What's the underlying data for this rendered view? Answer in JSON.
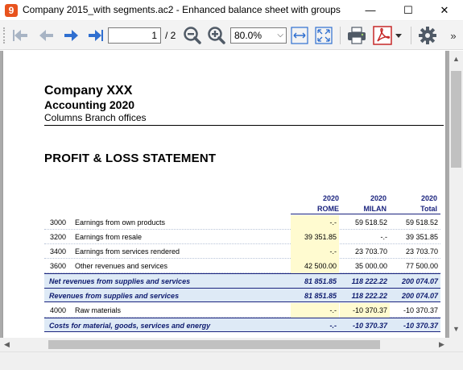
{
  "window": {
    "title": "Company 2015_with segments.ac2 - Enhanced balance sheet with groups",
    "app_icon": "9",
    "minimize": "—",
    "maximize": "☐",
    "close": "✕"
  },
  "toolbar": {
    "page_current": "1",
    "page_total": "/ 2",
    "zoom": "80.0%",
    "more": "»",
    "accent_color": "#2f6fd0"
  },
  "report": {
    "company": "Company XXX",
    "accounting": "Accounting 2020",
    "columns_label": "Columns Branch offices",
    "section_title": "PROFIT & LOSS STATEMENT",
    "columns": [
      {
        "year": "2020",
        "name": "ROME"
      },
      {
        "year": "2020",
        "name": "MILAN"
      },
      {
        "year": "2020",
        "name": "Total"
      }
    ],
    "rows": [
      {
        "acct": "3000",
        "desc": "Earnings from own products",
        "v1": "-.-",
        "v2": "59 518.52",
        "v3": "59 518.52"
      },
      {
        "acct": "3200",
        "desc": "Earnings from resale",
        "v1": "39 351.85",
        "v2": "-.-",
        "v3": "39 351.85"
      },
      {
        "acct": "3400",
        "desc": "Earnings from services rendered",
        "v1": "-.-",
        "v2": "23 703.70",
        "v3": "23 703.70"
      },
      {
        "acct": "3600",
        "desc": "Other revenues and services",
        "v1": "42 500.00",
        "v2": "35 000.00",
        "v3": "77 500.00"
      }
    ],
    "totals1": [
      {
        "desc": "Net revenues from supplies and services",
        "v1": "81 851.85",
        "v2": "118 222.22",
        "v3": "200 074.07"
      },
      {
        "desc": "Revenues from supplies and services",
        "v1": "81 851.85",
        "v2": "118 222.22",
        "v3": "200 074.07"
      }
    ],
    "row_raw": {
      "acct": "4000",
      "desc": "Raw materials",
      "v1": "-.-",
      "v2": "-10 370.37",
      "v3": "-10 370.37"
    },
    "total_costs": {
      "desc": "Costs for material, goods, services and energy",
      "v1": "-.-",
      "v2": "-10 370.37",
      "v3": "-10 370.37"
    }
  }
}
